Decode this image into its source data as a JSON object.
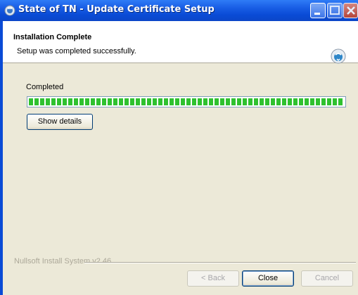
{
  "window": {
    "title": "State of TN - Update Certificate Setup",
    "icon": "setup-globe-icon"
  },
  "titlebar_buttons": [
    "minimize-icon",
    "maximize-icon",
    "close-icon"
  ],
  "header": {
    "title": "Installation Complete",
    "subtitle": "Setup was completed successfully.",
    "icon": "installer-globe-icon"
  },
  "progress": {
    "label": "Completed",
    "value_percent": 100
  },
  "buttons": {
    "show_details": "Show details",
    "back": "< Back",
    "close": "Close",
    "cancel": "Cancel"
  },
  "branding": {
    "text": "Nullsoft Install System v2.46"
  },
  "colors": {
    "titlebar": "#0a4bd6",
    "progress_fill": "#2fc12f",
    "dialog_bg": "#ece9d8"
  }
}
